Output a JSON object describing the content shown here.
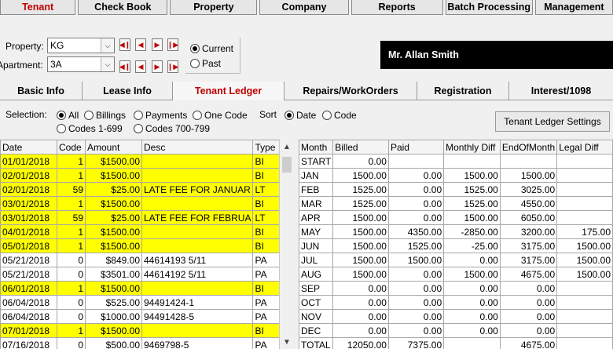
{
  "top_menu": [
    "Tenant",
    "Check Book",
    "Property",
    "Company",
    "Reports",
    "Batch Processing",
    "Management"
  ],
  "filters": {
    "property_label": "Property:",
    "property_value": "KG",
    "apartment_label": "Apartment:",
    "apartment_value": "3A",
    "current_label": "Current",
    "past_label": "Past"
  },
  "tenant_name": "Mr. Allan Smith",
  "tabs": [
    "Basic Info",
    "Lease Info",
    "Tenant Ledger",
    "Repairs/WorkOrders",
    "Registration",
    "Interest/1098"
  ],
  "selection": {
    "label": "Selection:",
    "options": [
      "All",
      "Billings",
      "Payments",
      "One Code",
      "Codes 1-699",
      "Codes 700-799"
    ],
    "sort_label": "Sort",
    "sort_options": [
      "Date",
      "Code"
    ],
    "settings_button": "Tenant Ledger Settings"
  },
  "ledger": {
    "columns": [
      "Date",
      "Code",
      "Amount",
      "Desc",
      "Type"
    ],
    "rows": [
      {
        "date": "01/01/2018",
        "code": "1",
        "amount": "$1500.00",
        "desc": "",
        "type": "BI",
        "hl": true
      },
      {
        "date": "02/01/2018",
        "code": "1",
        "amount": "$1500.00",
        "desc": "",
        "type": "BI",
        "hl": true
      },
      {
        "date": "02/01/2018",
        "code": "59",
        "amount": "$25.00",
        "desc": "LATE FEE FOR JANUAR",
        "type": "LT",
        "hl": true
      },
      {
        "date": "03/01/2018",
        "code": "1",
        "amount": "$1500.00",
        "desc": "",
        "type": "BI",
        "hl": true
      },
      {
        "date": "03/01/2018",
        "code": "59",
        "amount": "$25.00",
        "desc": "LATE FEE FOR FEBRUA",
        "type": "LT",
        "hl": true
      },
      {
        "date": "04/01/2018",
        "code": "1",
        "amount": "$1500.00",
        "desc": "",
        "type": "BI",
        "hl": true
      },
      {
        "date": "05/01/2018",
        "code": "1",
        "amount": "$1500.00",
        "desc": "",
        "type": "BI",
        "hl": true
      },
      {
        "date": "05/21/2018",
        "code": "0",
        "amount": "$849.00",
        "desc": "44614193 5/11",
        "type": "PA",
        "hl": false
      },
      {
        "date": "05/21/2018",
        "code": "0",
        "amount": "$3501.00",
        "desc": "44614192 5/11",
        "type": "PA",
        "hl": false
      },
      {
        "date": "06/01/2018",
        "code": "1",
        "amount": "$1500.00",
        "desc": "",
        "type": "BI",
        "hl": true
      },
      {
        "date": "06/04/2018",
        "code": "0",
        "amount": "$525.00",
        "desc": "94491424-1",
        "type": "PA",
        "hl": false
      },
      {
        "date": "06/04/2018",
        "code": "0",
        "amount": "$1000.00",
        "desc": "94491428-5",
        "type": "PA",
        "hl": false
      },
      {
        "date": "07/01/2018",
        "code": "1",
        "amount": "$1500.00",
        "desc": "",
        "type": "BI",
        "hl": true
      },
      {
        "date": "07/16/2018",
        "code": "0",
        "amount": "$500.00",
        "desc": "9469798-5",
        "type": "PA",
        "hl": false
      }
    ]
  },
  "monthly": {
    "columns": [
      "Month",
      "Billed",
      "Paid",
      "Monthly Diff",
      "EndOfMonth",
      "Legal Diff"
    ],
    "rows": [
      {
        "month": "START",
        "billed": "0.00",
        "paid": "",
        "diff": "",
        "eom": "",
        "legal": ""
      },
      {
        "month": "JAN",
        "billed": "1500.00",
        "paid": "0.00",
        "diff": "1500.00",
        "eom": "1500.00",
        "legal": ""
      },
      {
        "month": "FEB",
        "billed": "1525.00",
        "paid": "0.00",
        "diff": "1525.00",
        "eom": "3025.00",
        "legal": ""
      },
      {
        "month": "MAR",
        "billed": "1525.00",
        "paid": "0.00",
        "diff": "1525.00",
        "eom": "4550.00",
        "legal": ""
      },
      {
        "month": "APR",
        "billed": "1500.00",
        "paid": "0.00",
        "diff": "1500.00",
        "eom": "6050.00",
        "legal": ""
      },
      {
        "month": "MAY",
        "billed": "1500.00",
        "paid": "4350.00",
        "diff": "-2850.00",
        "eom": "3200.00",
        "legal": "175.00"
      },
      {
        "month": "JUN",
        "billed": "1500.00",
        "paid": "1525.00",
        "diff": "-25.00",
        "eom": "3175.00",
        "legal": "1500.00"
      },
      {
        "month": "JUL",
        "billed": "1500.00",
        "paid": "1500.00",
        "diff": "0.00",
        "eom": "3175.00",
        "legal": "1500.00"
      },
      {
        "month": "AUG",
        "billed": "1500.00",
        "paid": "0.00",
        "diff": "1500.00",
        "eom": "4675.00",
        "legal": "1500.00"
      },
      {
        "month": "SEP",
        "billed": "0.00",
        "paid": "0.00",
        "diff": "0.00",
        "eom": "0.00",
        "legal": ""
      },
      {
        "month": "OCT",
        "billed": "0.00",
        "paid": "0.00",
        "diff": "0.00",
        "eom": "0.00",
        "legal": ""
      },
      {
        "month": "NOV",
        "billed": "0.00",
        "paid": "0.00",
        "diff": "0.00",
        "eom": "0.00",
        "legal": ""
      },
      {
        "month": "DEC",
        "billed": "0.00",
        "paid": "0.00",
        "diff": "0.00",
        "eom": "0.00",
        "legal": ""
      },
      {
        "month": "TOTAL",
        "billed": "12050.00",
        "paid": "7375.00",
        "diff": "",
        "eom": "4675.00",
        "legal": ""
      }
    ]
  }
}
